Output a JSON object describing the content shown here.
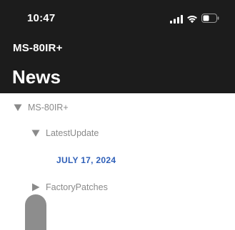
{
  "status_bar": {
    "time": "10:47",
    "icons": [
      "signal-icon",
      "wifi-icon",
      "battery-icon"
    ]
  },
  "header": {
    "device_name": "MS-80IR+",
    "title": "News"
  },
  "tree": {
    "root": {
      "label": "MS-80IR+",
      "expanded": true
    },
    "group_latest": {
      "label": "LatestUpdate",
      "expanded": true
    },
    "item_date": {
      "label": "JULY 17, 2024"
    },
    "group_factory": {
      "label": "FactoryPatches",
      "expanded": false
    }
  },
  "colors": {
    "header_bg": "#1c1c1c",
    "tree_text": "#8a8a8a",
    "link_blue": "#2e5fb8"
  }
}
